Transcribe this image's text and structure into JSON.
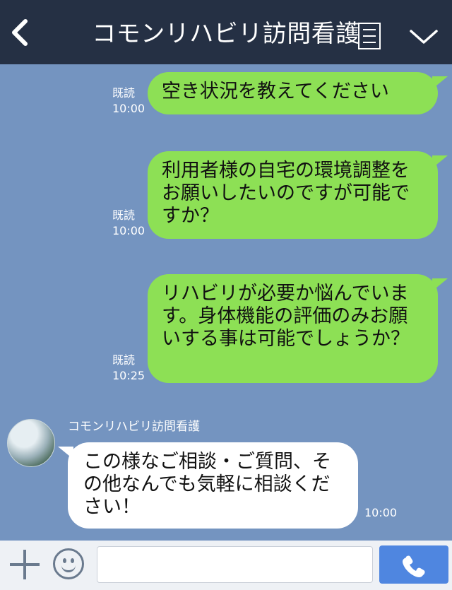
{
  "header": {
    "title": "コモンリハビリ訪問看護",
    "bg": "#253044"
  },
  "messages_out": [
    {
      "text": "空き状況を教えてください",
      "read": "既読",
      "time": "10:00"
    },
    {
      "text": "利用者様の自宅の環境調整をお願いしたいのですが可能ですか？",
      "read": "既読",
      "time": "10:00"
    },
    {
      "text": "リハビリが必要か悩んでいます。身体機能の評価のみお願いする事は可能でしょうか？",
      "read": "既読",
      "time": "10:25"
    }
  ],
  "message_in": {
    "sender": "コモンリハビリ訪問看護",
    "text": "この様なご相談・ご質問、その他なんでも気軽に相談ください！",
    "time": "10:00"
  },
  "input": {
    "value": "",
    "placeholder": ""
  },
  "colors": {
    "chat_bg": "#7494c0",
    "bubble_out": "#8de055",
    "bubble_in": "#ffffff",
    "call_button": "#4f86e0"
  },
  "icons": [
    "back-chevron-icon",
    "menu-icon",
    "chevron-down-icon",
    "plus-icon",
    "emoji-icon",
    "phone-icon"
  ]
}
